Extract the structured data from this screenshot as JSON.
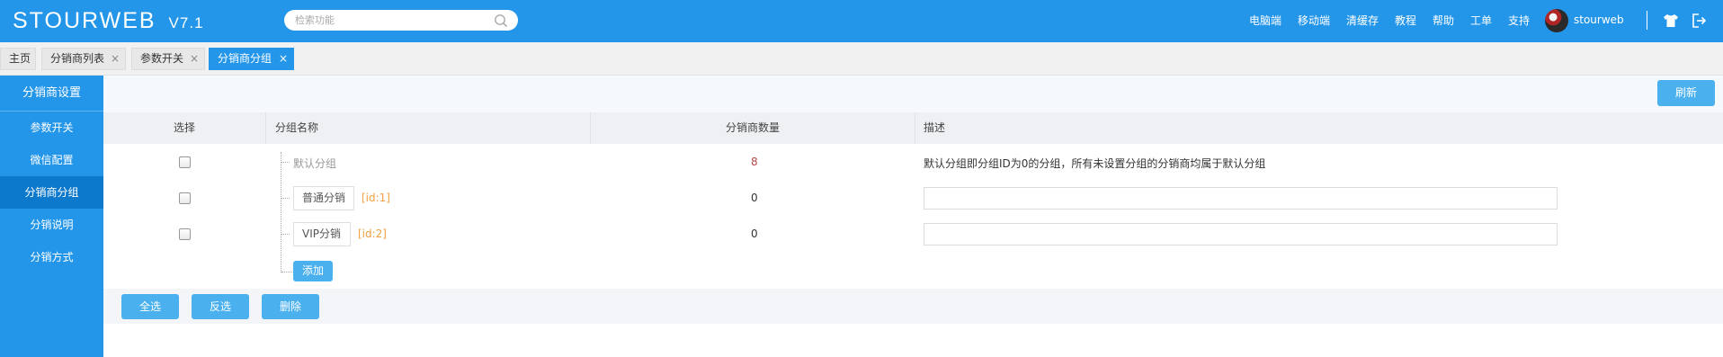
{
  "header": {
    "logo": "STOURWEB",
    "version": "V7.1",
    "search_placeholder": "检索功能",
    "nav": [
      "电脑端",
      "移动端",
      "清缓存",
      "教程",
      "帮助",
      "工单",
      "支持"
    ],
    "username": "stourweb",
    "icons": [
      "tshirt-icon",
      "logout-icon"
    ]
  },
  "tabs": [
    {
      "label": "主页",
      "closable": false,
      "active": false
    },
    {
      "label": "分销商列表",
      "closable": true,
      "active": false
    },
    {
      "label": "参数开关",
      "closable": true,
      "active": false
    },
    {
      "label": "分销商分组",
      "closable": true,
      "active": true
    }
  ],
  "close_glyph": "×",
  "sidebar": {
    "title": "分销商设置",
    "items": [
      {
        "label": "参数开关",
        "active": false
      },
      {
        "label": "微信配置",
        "active": false
      },
      {
        "label": "分销商分组",
        "active": true
      },
      {
        "label": "分销说明",
        "active": false
      },
      {
        "label": "分销方式",
        "active": false
      }
    ]
  },
  "toolbar": {
    "refresh_label": "刷新"
  },
  "table": {
    "headers": [
      "选择",
      "分组名称",
      "分销商数量",
      "描述"
    ],
    "rows": [
      {
        "name": "默认分组",
        "id_tag": "",
        "count": "8",
        "description": "默认分组即分组ID为0的分组，所有未设置分组的分销商均属于默认分组",
        "editable": false
      },
      {
        "name": "普通分销",
        "id_tag": "[id:1]",
        "count": "0",
        "description": "",
        "editable": true
      },
      {
        "name": "VIP分销",
        "id_tag": "[id:2]",
        "count": "0",
        "description": "",
        "editable": true
      }
    ],
    "add_label": "添加"
  },
  "footer": {
    "select_all": "全选",
    "invert": "反选",
    "delete": "删除"
  },
  "colors": {
    "primary": "#2496ea",
    "sidebar_active": "#0d79cc",
    "button": "#4ab0ee",
    "count_default": "#b5494a",
    "id_tag": "#f0a040"
  }
}
